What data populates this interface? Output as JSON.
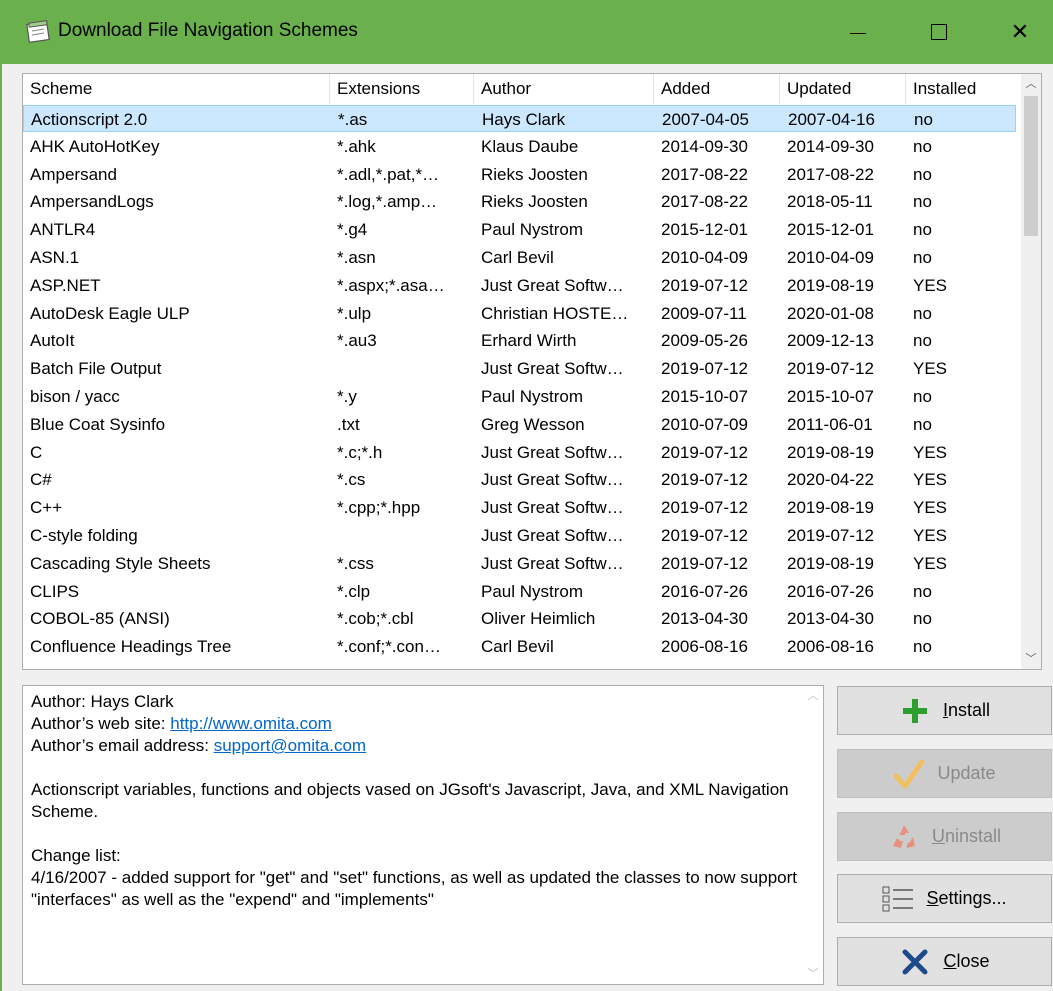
{
  "window": {
    "title": "Download File Navigation Schemes",
    "minimize": "—",
    "maximize": "☐",
    "close": "✕"
  },
  "list": {
    "columns": [
      "Scheme",
      "Extensions",
      "Author",
      "Added",
      "Updated",
      "Installed"
    ],
    "rows": [
      [
        "Actionscript 2.0",
        "*.as",
        "Hays Clark",
        "2007-04-05",
        "2007-04-16",
        "no"
      ],
      [
        "AHK AutoHotKey",
        "*.ahk",
        "Klaus Daube",
        "2014-09-30",
        "2014-09-30",
        "no"
      ],
      [
        "Ampersand",
        "*.adl,*.pat,*…",
        "Rieks Joosten",
        "2017-08-22",
        "2017-08-22",
        "no"
      ],
      [
        "AmpersandLogs",
        "*.log,*.amp…",
        "Rieks Joosten",
        "2017-08-22",
        "2018-05-11",
        "no"
      ],
      [
        "ANTLR4",
        "*.g4",
        "Paul Nystrom",
        "2015-12-01",
        "2015-12-01",
        "no"
      ],
      [
        "ASN.1",
        "*.asn",
        "Carl Bevil",
        "2010-04-09",
        "2010-04-09",
        "no"
      ],
      [
        "ASP.NET",
        "*.aspx;*.asa…",
        "Just Great Softw…",
        "2019-07-12",
        "2019-08-19",
        "YES"
      ],
      [
        "AutoDesk Eagle ULP",
        "*.ulp",
        "Christian HOSTE…",
        "2009-07-11",
        "2020-01-08",
        "no"
      ],
      [
        "AutoIt",
        "*.au3",
        "Erhard Wirth",
        "2009-05-26",
        "2009-12-13",
        "no"
      ],
      [
        "Batch File Output",
        "",
        "Just Great Softw…",
        "2019-07-12",
        "2019-07-12",
        "YES"
      ],
      [
        "bison / yacc",
        "*.y",
        "Paul Nystrom",
        "2015-10-07",
        "2015-10-07",
        "no"
      ],
      [
        "Blue Coat Sysinfo",
        ".txt",
        "Greg Wesson",
        "2010-07-09",
        "2011-06-01",
        "no"
      ],
      [
        "C",
        "*.c;*.h",
        "Just Great Softw…",
        "2019-07-12",
        "2019-08-19",
        "YES"
      ],
      [
        "C#",
        "*.cs",
        "Just Great Softw…",
        "2019-07-12",
        "2020-04-22",
        "YES"
      ],
      [
        "C++",
        "*.cpp;*.hpp",
        "Just Great Softw…",
        "2019-07-12",
        "2019-08-19",
        "YES"
      ],
      [
        "C-style folding",
        "",
        "Just Great Softw…",
        "2019-07-12",
        "2019-07-12",
        "YES"
      ],
      [
        "Cascading Style Sheets",
        "*.css",
        "Just Great Softw…",
        "2019-07-12",
        "2019-08-19",
        "YES"
      ],
      [
        "CLIPS",
        "*.clp",
        "Paul Nystrom",
        "2016-07-26",
        "2016-07-26",
        "no"
      ],
      [
        "COBOL-85 (ANSI)",
        "*.cob;*.cbl",
        "Oliver Heimlich",
        "2013-04-30",
        "2013-04-30",
        "no"
      ],
      [
        "Confluence Headings Tree",
        "*.conf;*.con…",
        "Carl Bevil",
        "2006-08-16",
        "2006-08-16",
        "no"
      ]
    ],
    "selected_index": 0
  },
  "info": {
    "author_line": "Author: Hays Clark",
    "website_label": "Author’s web site: ",
    "website_url": "http://www.omita.com",
    "email_label": "Author’s email address: ",
    "email": "support@omita.com",
    "description": "Actionscript variables, functions and objects vased on JGsoft's Javascript, Java, and XML Navigation Scheme.",
    "changelist_heading": "Change list:",
    "changelist_text": "4/16/2007 - added support for \"get\" and \"set\" functions, as well as updated the classes to now support \"interfaces\" as well as the \"expend\" and \"implements\""
  },
  "buttons": {
    "install": {
      "prefix": "",
      "accel": "I",
      "rest": "nstall",
      "enabled": true
    },
    "update": {
      "label": "Update",
      "enabled": false
    },
    "uninstall": {
      "prefix": "",
      "accel": "U",
      "rest": "ninstall",
      "enabled": false
    },
    "settings": {
      "prefix": "",
      "accel": "S",
      "rest": "ettings...",
      "enabled": true
    },
    "close": {
      "prefix": "",
      "accel": "C",
      "rest": "lose",
      "enabled": true
    }
  },
  "colors": {
    "titlebar": "#6ab04c",
    "selection": "#cce8ff",
    "install_icon": "#2e9e2e",
    "update_icon": "#f0c060",
    "uninstall_icon": "#e89080",
    "close_icon": "#1f4a8a",
    "link": "#0066cc"
  },
  "icons": {
    "app": "notepad-icon",
    "install": "plus-icon",
    "update": "checkmark-icon",
    "uninstall": "recycle-icon",
    "settings": "checklist-icon",
    "close": "x-icon"
  }
}
